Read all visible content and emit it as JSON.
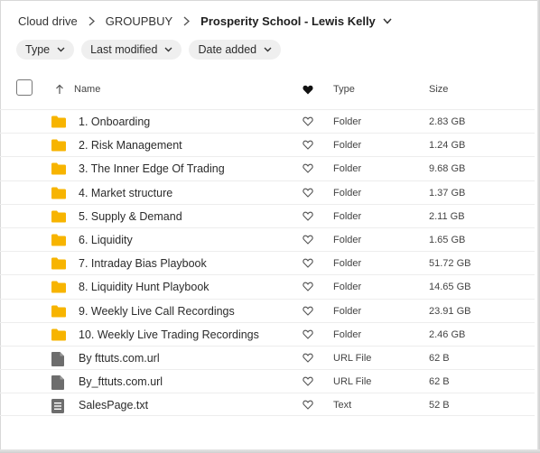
{
  "breadcrumb": {
    "root": "Cloud drive",
    "parent": "GROUPBUY",
    "current": "Prosperity School - Lewis Kelly"
  },
  "filters": [
    {
      "label": "Type"
    },
    {
      "label": "Last modified"
    },
    {
      "label": "Date added"
    }
  ],
  "columns": {
    "name": "Name",
    "type": "Type",
    "size": "Size"
  },
  "icons": {
    "folder": "folder-icon",
    "file": "file-icon",
    "text_file": "text-file-icon",
    "favorite": "heart-icon",
    "sort": "sort-arrow-up-icon"
  },
  "colors": {
    "folder": "#f7b400",
    "file": "#6d6d6d"
  },
  "files": [
    {
      "name": "1. Onboarding",
      "type": "Folder",
      "size": "2.83 GB",
      "kind": "folder"
    },
    {
      "name": "2. Risk Management",
      "type": "Folder",
      "size": "1.24 GB",
      "kind": "folder"
    },
    {
      "name": "3. The Inner Edge Of Trading",
      "type": "Folder",
      "size": "9.68 GB",
      "kind": "folder"
    },
    {
      "name": "4. Market structure",
      "type": "Folder",
      "size": "1.37 GB",
      "kind": "folder"
    },
    {
      "name": "5. Supply & Demand",
      "type": "Folder",
      "size": "2.11 GB",
      "kind": "folder"
    },
    {
      "name": "6. Liquidity",
      "type": "Folder",
      "size": "1.65 GB",
      "kind": "folder"
    },
    {
      "name": "7. Intraday Bias Playbook",
      "type": "Folder",
      "size": "51.72 GB",
      "kind": "folder"
    },
    {
      "name": "8. Liquidity Hunt Playbook",
      "type": "Folder",
      "size": "14.65 GB",
      "kind": "folder"
    },
    {
      "name": "9. Weekly Live Call Recordings",
      "type": "Folder",
      "size": "23.91 GB",
      "kind": "folder"
    },
    {
      "name": "10. Weekly Live Trading Recordings",
      "type": "Folder",
      "size": "2.46 GB",
      "kind": "folder"
    },
    {
      "name": "By fttuts.com.url",
      "type": "URL File",
      "size": "62 B",
      "kind": "file"
    },
    {
      "name": "By_fttuts.com.url",
      "type": "URL File",
      "size": "62 B",
      "kind": "file"
    },
    {
      "name": "SalesPage.txt",
      "type": "Text",
      "size": "52 B",
      "kind": "text"
    }
  ]
}
